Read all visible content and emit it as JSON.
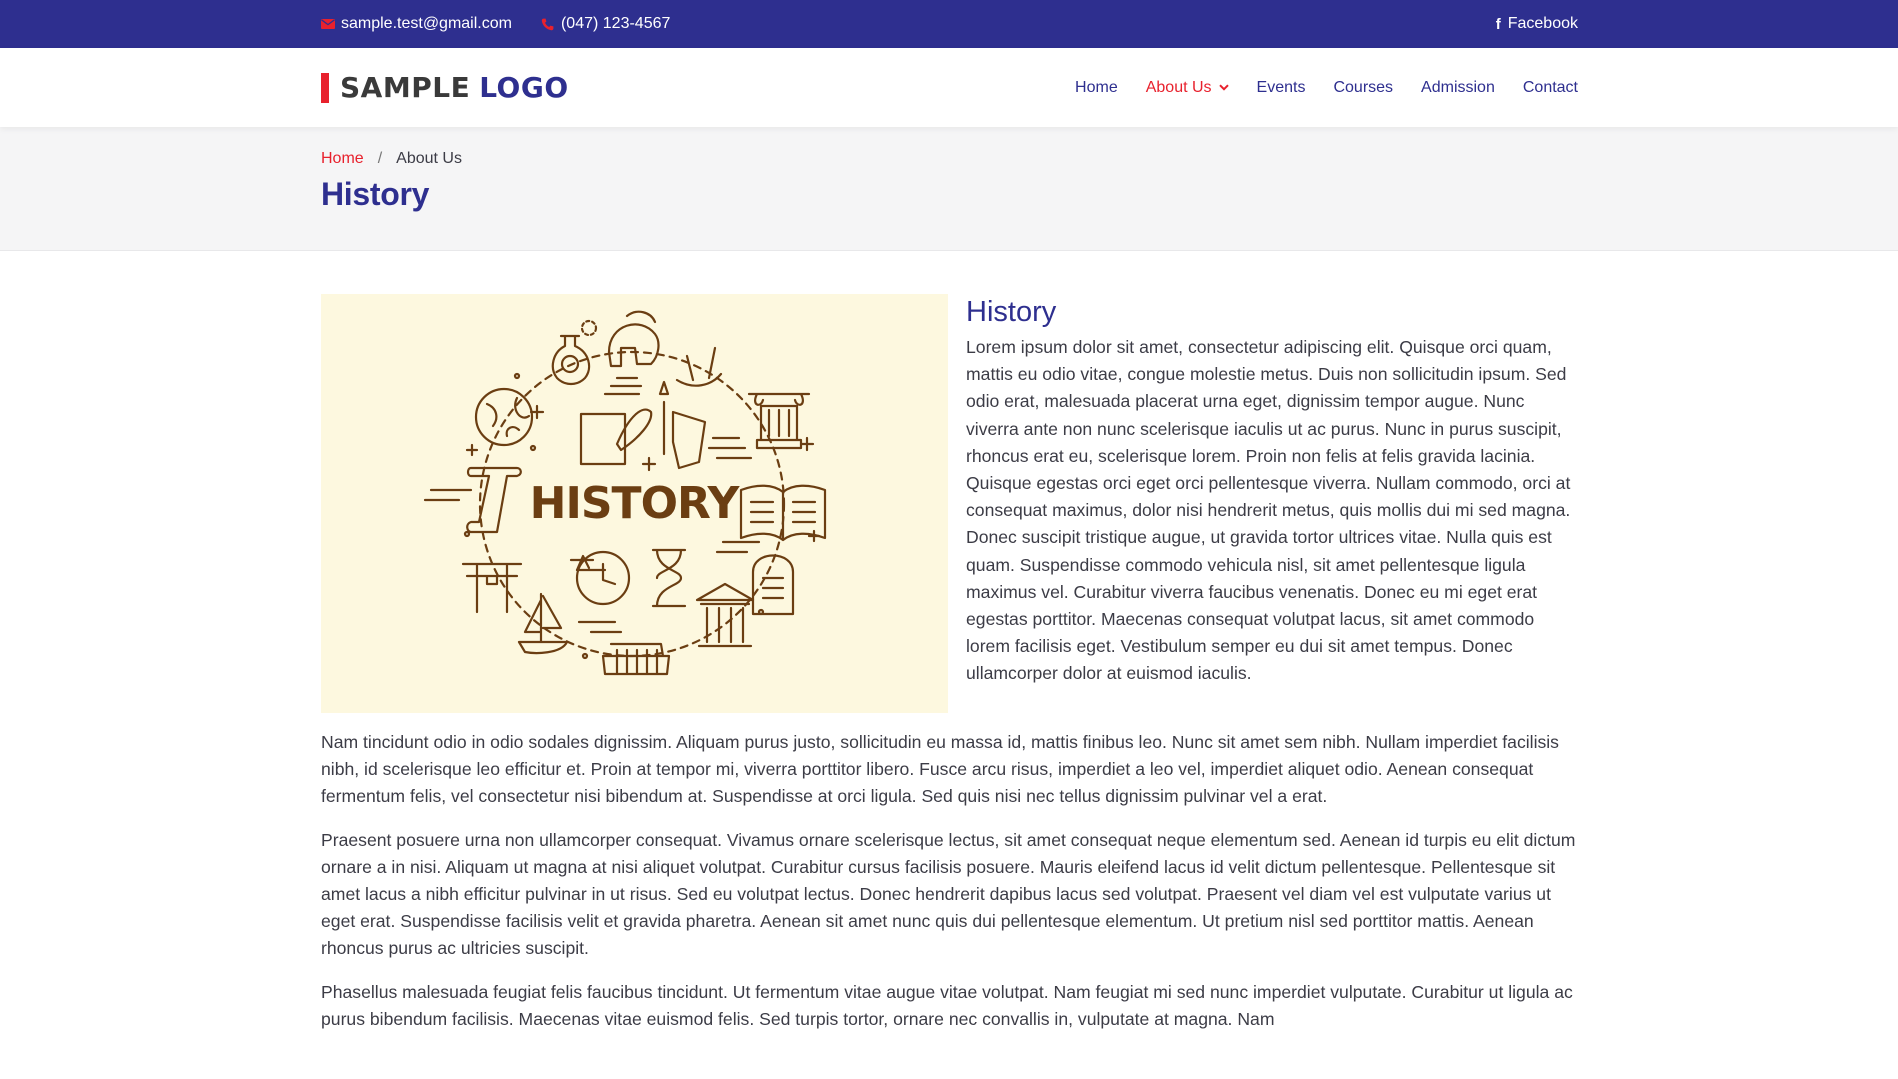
{
  "topbar": {
    "email": "sample.test@gmail.com",
    "phone": "(047) 123-4567",
    "social": "Facebook",
    "icons": {
      "email": "envelope-icon",
      "phone": "phone-icon",
      "social": "facebook-icon"
    }
  },
  "header": {
    "logo_part1": "SAMPLE",
    "logo_part2": "LOGO",
    "nav": {
      "home": "Home",
      "about": "About Us",
      "events": "Events",
      "courses": "Courses",
      "admission": "Admission",
      "contact": "Contact"
    }
  },
  "breadcrumb": {
    "home": "Home",
    "separator": "/",
    "current": "About Us"
  },
  "page_title": "History",
  "content": {
    "image_text": "HISTORY",
    "section_title": "History",
    "paragraph1": "Lorem ipsum dolor sit amet, consectetur adipiscing elit. Quisque orci quam, mattis eu odio vitae, congue molestie metus. Duis non sollicitudin ipsum. Sed odio erat, malesuada placerat urna eget, dignissim tempor augue. Nunc viverra ante non nunc scelerisque iaculis ut ac purus. Nunc in purus suscipit, rhoncus erat eu, scelerisque lorem. Proin non felis at felis gravida lacinia. Quisque egestas orci eget orci pellentesque viverra. Nullam commodo, orci at consequat maximus, dolor nisi hendrerit metus, quis mollis dui mi sed magna. Donec suscipit tristique augue, ut gravida tortor ultrices vitae. Nulla quis est quam. Suspendisse commodo vehicula nisl, sit amet pellentesque ligula maximus vel. Curabitur viverra faucibus venenatis. Donec eu mi eget erat egestas porttitor. Maecenas consequat volutpat lacus, sit amet commodo lorem facilisis eget. Vestibulum semper eu dui sit amet tempus. Donec ullamcorper dolor at euismod iaculis.",
    "paragraph2": "Nam tincidunt odio in odio sodales dignissim. Aliquam purus justo, sollicitudin eu massa id, mattis finibus leo. Nunc sit amet sem nibh. Nullam imperdiet facilisis nibh, id scelerisque leo efficitur et. Proin at tempor mi, viverra porttitor libero. Fusce arcu risus, imperdiet a leo vel, imperdiet aliquet odio. Aenean consequat fermentum felis, vel consectetur nisi bibendum at. Suspendisse at orci ligula. Sed quis nisi nec tellus dignissim pulvinar vel a erat.",
    "paragraph3": "Praesent posuere urna non ullamcorper consequat. Vivamus ornare scelerisque lectus, sit amet consequat neque elementum sed. Aenean id turpis eu elit dictum ornare a in nisi. Aliquam ut magna at nisi aliquet volutpat. Curabitur cursus facilisis posuere. Mauris eleifend lacus id velit dictum pellentesque. Pellentesque sit amet lacus a nibh efficitur pulvinar in ut risus. Sed eu volutpat lectus. Donec hendrerit dapibus lacus sed volutpat. Praesent vel diam vel est vulputate varius ut eget erat. Suspendisse facilisis velit et gravida pharetra. Aenean sit amet nunc quis dui pellentesque elementum. Ut pretium nisl sed porttitor mattis. Aenean rhoncus purus ac ultricies suscipit.",
    "paragraph4": "Phasellus malesuada feugiat felis faucibus tincidunt. Ut fermentum vitae augue vitae volutpat. Nam feugiat mi sed nunc imperdiet vulputate. Curabitur ut ligula ac purus bibendum facilisis. Maecenas vitae euismod felis. Sed turpis tortor, ornare nec convallis in, vulputate at magna. Nam"
  },
  "colors": {
    "primary": "#2e2f8f",
    "accent": "#e8212d",
    "banner_bg": "#f5f5f6",
    "image_bg": "#fdf8df",
    "illustration": "#6b3e12"
  }
}
